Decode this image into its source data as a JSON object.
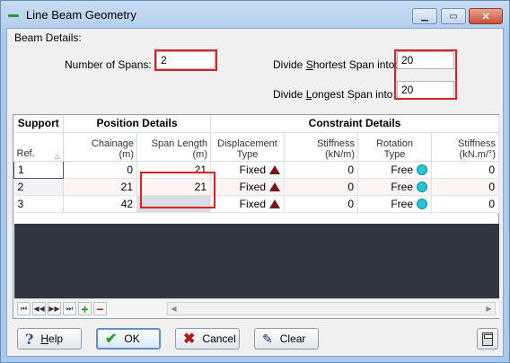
{
  "window": {
    "title": "Line Beam Geometry",
    "minimize_label": "▁",
    "maximize_label": "▭",
    "close_label": "✕"
  },
  "beam_details": {
    "group_label": "Beam Details:",
    "num_spans_label_pre": "Number of Spans:",
    "num_spans_value": "2",
    "shortest_label_pre": "Divide ",
    "shortest_label_u": "S",
    "shortest_label_post": "hortest Span into:",
    "shortest_value": "20",
    "longest_label_pre": "Divide ",
    "longest_label_u": "L",
    "longest_label_post": "ongest Span into:",
    "longest_value": "20"
  },
  "grid": {
    "group_headers": [
      "Support",
      "Position Details",
      "Constraint Details"
    ],
    "col_headers": [
      [
        "Ref."
      ],
      [
        "Chainage",
        "(m)"
      ],
      [
        "Span Length",
        "(m)"
      ],
      [
        "Displacement",
        "Type"
      ],
      [
        "Stiffness",
        "(kN/m)"
      ],
      [
        "Rotation",
        "Type"
      ],
      [
        "Stiffness",
        "(kN.m/°)"
      ]
    ],
    "rows": [
      {
        "ref": "1",
        "chainage": "0",
        "span": "21",
        "disp": "Fixed",
        "stiff": "0",
        "rot": "Free",
        "rstiff": "0"
      },
      {
        "ref": "2",
        "chainage": "21",
        "span": "21",
        "disp": "Fixed",
        "stiff": "0",
        "rot": "Free",
        "rstiff": "0"
      },
      {
        "ref": "3",
        "chainage": "42",
        "span": "",
        "disp": "Fixed",
        "stiff": "0",
        "rot": "Free",
        "rstiff": "0"
      }
    ],
    "nav_first": "⏮",
    "nav_prev": "◀◀",
    "nav_next": "▶▶",
    "nav_last": "⏭",
    "nav_add": "+",
    "nav_remove": "−"
  },
  "buttons": {
    "help_u": "H",
    "help_rest": "elp",
    "ok": "OK",
    "cancel": "Cancel",
    "clear": "Clear"
  },
  "colors": {
    "highlight_box": "#e02020",
    "title_bar": "#b3cfee",
    "fixed_icon": "#7a1616",
    "free_icon": "#25c6d6"
  }
}
